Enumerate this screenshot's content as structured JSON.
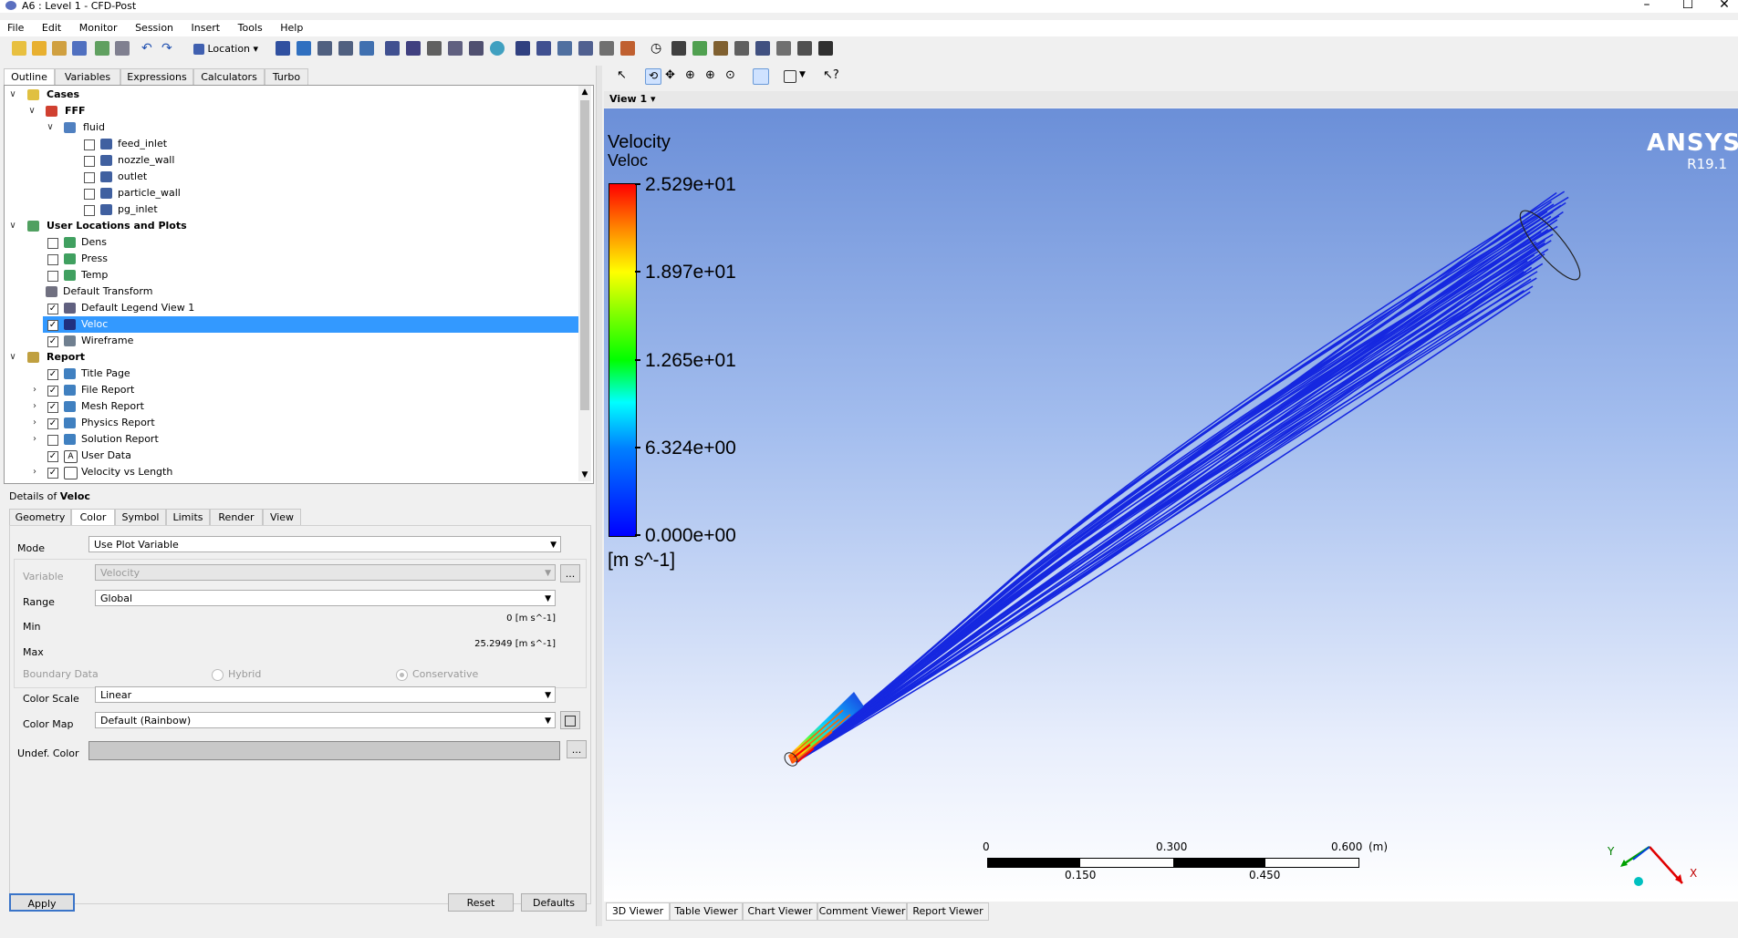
{
  "window": {
    "title": "A6 : Level 1 - CFD-Post"
  },
  "menu": [
    "File",
    "Edit",
    "Monitor",
    "Session",
    "Insert",
    "Tools",
    "Help"
  ],
  "toolbar": {
    "location_label": "Location"
  },
  "left_tabs": [
    "Outline",
    "Variables",
    "Expressions",
    "Calculators",
    "Turbo"
  ],
  "tree": {
    "cases": "Cases",
    "case_name": "FFF",
    "domain": "fluid",
    "boundaries": [
      "feed_inlet",
      "nozzle_wall",
      "outlet",
      "particle_wall",
      "pg_inlet"
    ],
    "user_locations": "User Locations and Plots",
    "user_items": [
      {
        "label": "Dens",
        "checked": false
      },
      {
        "label": "Press",
        "checked": false
      },
      {
        "label": "Temp",
        "checked": false
      },
      {
        "label": "Default Transform",
        "checked": null
      },
      {
        "label": "Default Legend View 1",
        "checked": true
      },
      {
        "label": "Veloc",
        "checked": true,
        "selected": true
      },
      {
        "label": "Wireframe",
        "checked": true
      }
    ],
    "report": "Report",
    "report_items": [
      {
        "label": "Title Page",
        "checked": true,
        "expand": false
      },
      {
        "label": "File Report",
        "checked": true,
        "expand": true
      },
      {
        "label": "Mesh Report",
        "checked": true,
        "expand": true
      },
      {
        "label": "Physics Report",
        "checked": true,
        "expand": true
      },
      {
        "label": "Solution Report",
        "checked": false,
        "expand": true
      },
      {
        "label": "User Data",
        "checked": true,
        "expand": false
      },
      {
        "label": "Velocity vs Length",
        "checked": true,
        "expand": true
      }
    ]
  },
  "details": {
    "prefix": "Details of ",
    "object": "Veloc",
    "tabs": [
      "Geometry",
      "Color",
      "Symbol",
      "Limits",
      "Render",
      "View"
    ],
    "mode_label": "Mode",
    "mode_value": "Use Plot Variable",
    "variable_label": "Variable",
    "variable_value": "Velocity",
    "range_label": "Range",
    "range_value": "Global",
    "min_label": "Min",
    "min_value": "0 [m s^-1]",
    "max_label": "Max",
    "max_value": "25.2949 [m s^-1]",
    "boundary_label": "Boundary Data",
    "hybrid_label": "Hybrid",
    "conservative_label": "Conservative",
    "colorscale_label": "Color Scale",
    "colorscale_value": "Linear",
    "colormap_label": "Color Map",
    "colormap_value": "Default (Rainbow)",
    "undef_label": "Undef. Color",
    "ellipsis": "...",
    "apply": "Apply",
    "reset": "Reset",
    "defaults": "Defaults"
  },
  "viewer": {
    "view_label": "View 1",
    "legend_title": "Velocity",
    "legend_sub": "Veloc",
    "legend_ticks": [
      "2.529e+01",
      "1.897e+01",
      "1.265e+01",
      "6.324e+00",
      "0.000e+00"
    ],
    "legend_unit": "[m s^-1]",
    "brand": "ANSYS",
    "version": "R19.1",
    "scale_top": [
      "0",
      "0.300",
      "0.600",
      "(m)"
    ],
    "scale_bottom": [
      "0.150",
      "0.450"
    ],
    "axis_x": "X",
    "axis_y": "Y"
  },
  "bottom_tabs": [
    "3D Viewer",
    "Table Viewer",
    "Chart Viewer",
    "Comment Viewer",
    "Report Viewer"
  ]
}
